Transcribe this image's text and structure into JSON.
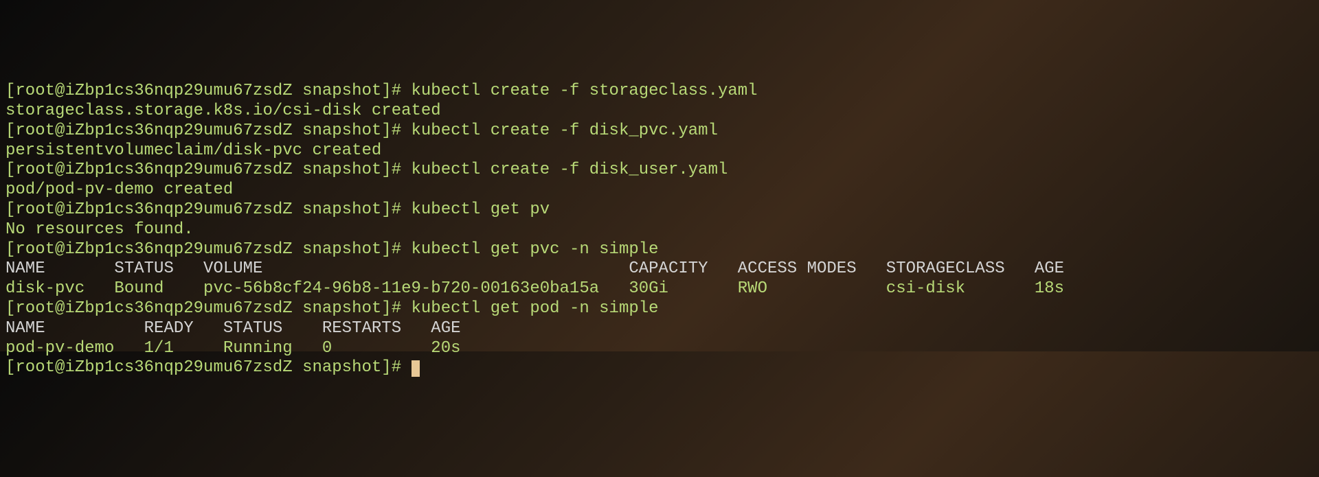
{
  "lines": [
    {
      "prompt": "[root@iZbp1cs36nqp29umu67zsdZ snapshot]# ",
      "cmd": "kubectl create -f storageclass.yaml"
    },
    {
      "output": "storageclass.storage.k8s.io/csi-disk created"
    },
    {
      "prompt": "[root@iZbp1cs36nqp29umu67zsdZ snapshot]# ",
      "cmd": "kubectl create -f disk_pvc.yaml"
    },
    {
      "output": "persistentvolumeclaim/disk-pvc created"
    },
    {
      "prompt": "[root@iZbp1cs36nqp29umu67zsdZ snapshot]# ",
      "cmd": "kubectl create -f disk_user.yaml"
    },
    {
      "output": "pod/pod-pv-demo created"
    },
    {
      "prompt": "[root@iZbp1cs36nqp29umu67zsdZ snapshot]# ",
      "cmd": "kubectl get pv"
    },
    {
      "output": "No resources found."
    },
    {
      "prompt": "[root@iZbp1cs36nqp29umu67zsdZ snapshot]# ",
      "cmd": "kubectl get pvc -n simple"
    },
    {
      "header": "NAME       STATUS   VOLUME                                     CAPACITY   ACCESS MODES   STORAGECLASS   AGE"
    },
    {
      "output": "disk-pvc   Bound    pvc-56b8cf24-96b8-11e9-b720-00163e0ba15a   30Gi       RWO            csi-disk       18s"
    },
    {
      "prompt": "[root@iZbp1cs36nqp29umu67zsdZ snapshot]# ",
      "cmd": "kubectl get pod -n simple"
    },
    {
      "header": "NAME          READY   STATUS    RESTARTS   AGE"
    },
    {
      "output": "pod-pv-demo   1/1     Running   0          20s"
    },
    {
      "prompt": "[root@iZbp1cs36nqp29umu67zsdZ snapshot]# ",
      "cursor": true
    }
  ]
}
